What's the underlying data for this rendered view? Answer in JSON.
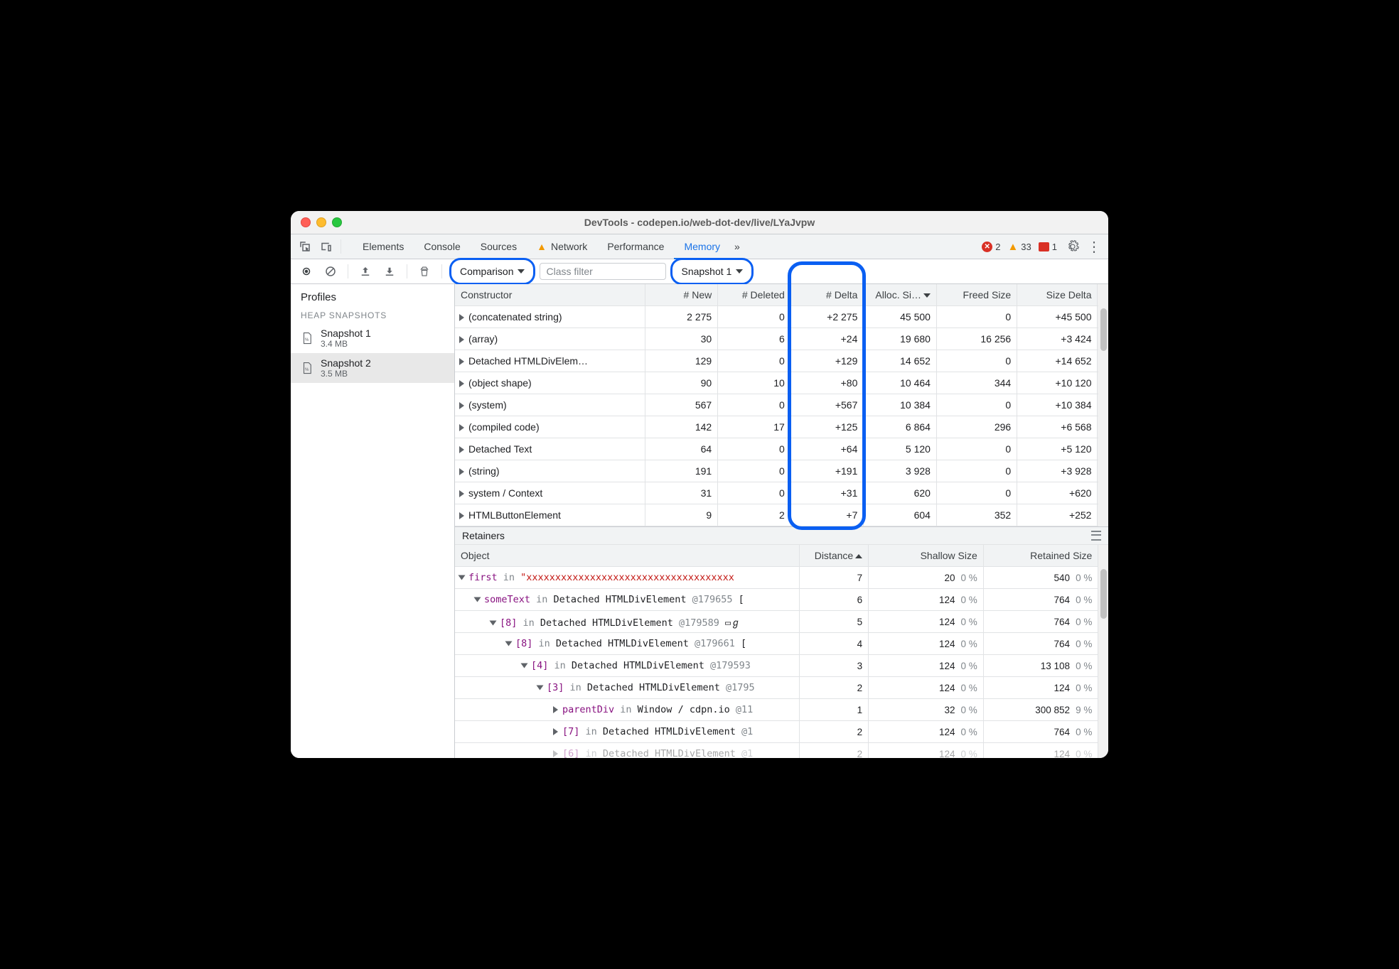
{
  "window_title": "DevTools - codepen.io/web-dot-dev/live/LYaJvpw",
  "tabs": [
    "Elements",
    "Console",
    "Sources",
    "Network",
    "Performance",
    "Memory"
  ],
  "active_tab": "Memory",
  "overflow": "»",
  "status": {
    "errors": 2,
    "warnings": 33,
    "messages": 1
  },
  "toolbar": {
    "view_dropdown": "Comparison",
    "classfilter_placeholder": "Class filter",
    "baseline_dropdown": "Snapshot 1"
  },
  "sidebar": {
    "title": "Profiles",
    "section": "HEAP SNAPSHOTS",
    "snapshots": [
      {
        "name": "Snapshot 1",
        "size": "3.4 MB",
        "selected": false
      },
      {
        "name": "Snapshot 2",
        "size": "3.5 MB",
        "selected": true
      }
    ]
  },
  "grid": {
    "headers": [
      "Constructor",
      "# New",
      "# Deleted",
      "# Delta",
      "Alloc. Si…",
      "Freed Size",
      "Size Delta"
    ],
    "sort_col": 4,
    "rows": [
      {
        "c": "(concatenated string)",
        "new": "2 275",
        "del": "0",
        "delta": "+2 275",
        "alloc": "45 500",
        "freed": "0",
        "sdelta": "+45 500"
      },
      {
        "c": "(array)",
        "new": "30",
        "del": "6",
        "delta": "+24",
        "alloc": "19 680",
        "freed": "16 256",
        "sdelta": "+3 424"
      },
      {
        "c": "Detached HTMLDivElem…",
        "new": "129",
        "del": "0",
        "delta": "+129",
        "alloc": "14 652",
        "freed": "0",
        "sdelta": "+14 652"
      },
      {
        "c": "(object shape)",
        "new": "90",
        "del": "10",
        "delta": "+80",
        "alloc": "10 464",
        "freed": "344",
        "sdelta": "+10 120"
      },
      {
        "c": "(system)",
        "new": "567",
        "del": "0",
        "delta": "+567",
        "alloc": "10 384",
        "freed": "0",
        "sdelta": "+10 384"
      },
      {
        "c": "(compiled code)",
        "new": "142",
        "del": "17",
        "delta": "+125",
        "alloc": "6 864",
        "freed": "296",
        "sdelta": "+6 568"
      },
      {
        "c": "Detached Text",
        "new": "64",
        "del": "0",
        "delta": "+64",
        "alloc": "5 120",
        "freed": "0",
        "sdelta": "+5 120"
      },
      {
        "c": "(string)",
        "new": "191",
        "del": "0",
        "delta": "+191",
        "alloc": "3 928",
        "freed": "0",
        "sdelta": "+3 928"
      },
      {
        "c": "system / Context",
        "new": "31",
        "del": "0",
        "delta": "+31",
        "alloc": "620",
        "freed": "0",
        "sdelta": "+620"
      },
      {
        "c": "HTMLButtonElement",
        "new": "9",
        "del": "2",
        "delta": "+7",
        "alloc": "604",
        "freed": "352",
        "sdelta": "+252"
      }
    ]
  },
  "retainers": {
    "title": "Retainers",
    "headers": [
      "Object",
      "Distance",
      "Shallow Size",
      "Retained Size"
    ],
    "sort_col": 1,
    "rows": [
      {
        "indent": 0,
        "open": true,
        "prefix": "first",
        "mid": " in ",
        "obj": "\"xxxxxxxxxxxxxxxxxxxxxxxxxxxxxxxxxxxx",
        "dist": "7",
        "shallow": "20",
        "spct": "0 %",
        "ret": "540",
        "rpct": "0 %",
        "str": true
      },
      {
        "indent": 1,
        "open": true,
        "prefix": "someText",
        "mid": " in ",
        "obj": "Detached HTMLDivElement",
        "id": "@179655",
        "trail": " [",
        "dist": "6",
        "shallow": "124",
        "spct": "0 %",
        "ret": "764",
        "rpct": "0 %"
      },
      {
        "indent": 2,
        "open": true,
        "prefix": "[8]",
        "mid": " in ",
        "obj": "Detached HTMLDivElement",
        "id": "@179589",
        "trail": " ▭ℊ",
        "dist": "5",
        "shallow": "124",
        "spct": "0 %",
        "ret": "764",
        "rpct": "0 %"
      },
      {
        "indent": 3,
        "open": true,
        "prefix": "[8]",
        "mid": " in ",
        "obj": "Detached HTMLDivElement",
        "id": "@179661",
        "trail": " [",
        "dist": "4",
        "shallow": "124",
        "spct": "0 %",
        "ret": "764",
        "rpct": "0 %"
      },
      {
        "indent": 4,
        "open": true,
        "prefix": "[4]",
        "mid": " in ",
        "obj": "Detached HTMLDivElement",
        "id": "@179593",
        "trail": "",
        "dist": "3",
        "shallow": "124",
        "spct": "0 %",
        "ret": "13 108",
        "rpct": "0 %"
      },
      {
        "indent": 5,
        "open": true,
        "prefix": "[3]",
        "mid": " in ",
        "obj": "Detached HTMLDivElement",
        "id": "@1795",
        "trail": "",
        "dist": "2",
        "shallow": "124",
        "spct": "0 %",
        "ret": "124",
        "rpct": "0 %"
      },
      {
        "indent": 6,
        "open": false,
        "prefix": "parentDiv",
        "mid": " in ",
        "obj": "Window / cdpn.io",
        "id": "@11",
        "trail": "",
        "dist": "1",
        "shallow": "32",
        "spct": "0 %",
        "ret": "300 852",
        "rpct": "9 %"
      },
      {
        "indent": 6,
        "open": false,
        "prefix": "[7]",
        "mid": " in ",
        "obj": "Detached HTMLDivElement",
        "id": "@1",
        "trail": "",
        "dist": "2",
        "shallow": "124",
        "spct": "0 %",
        "ret": "764",
        "rpct": "0 %"
      },
      {
        "indent": 6,
        "open": false,
        "prefix": "[6]",
        "mid": " in ",
        "obj": "Detached HTMLDivElement",
        "id": "@1",
        "trail": "",
        "dist": "2",
        "shallow": "124",
        "spct": "0 %",
        "ret": "124",
        "rpct": "0 %",
        "faded": true
      }
    ]
  }
}
